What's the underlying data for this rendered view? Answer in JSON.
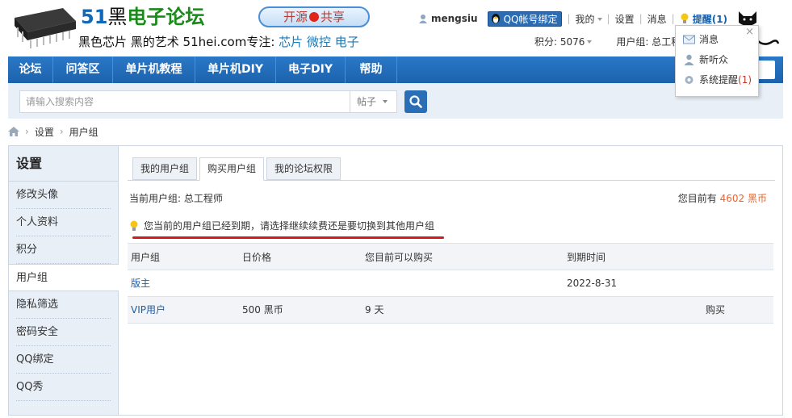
{
  "brand": {
    "num": "51",
    "hei": "黑",
    "rest": "电子论坛",
    "slogan_lead": "黑色芯片 黑的艺术 51hei.com专注:",
    "slogan_kw1": "芯片",
    "slogan_kw2": "微控",
    "slogan_kw3": "电子",
    "badge_left": "开源",
    "badge_right": "共享"
  },
  "topbar": {
    "username": "mengsiu",
    "qq_bind": "QQ帐号绑定",
    "mine": "我的",
    "settings": "设置",
    "messages": "消息",
    "remind": "提醒(1)"
  },
  "subbar": {
    "points": "积分: 5076",
    "usergroup": "用户组: 总工程"
  },
  "nav": {
    "items": [
      "论坛",
      "问答区",
      "单片机教程",
      "单片机DIY",
      "电子DIY",
      "帮助"
    ]
  },
  "search": {
    "placeholder": "请输入搜索内容",
    "type": "帖子"
  },
  "breadcrumb": {
    "item1": "设置",
    "item2": "用户组"
  },
  "sidebar": {
    "title": "设置",
    "items": [
      "修改头像",
      "个人资料",
      "积分",
      "用户组",
      "隐私筛选",
      "密码安全",
      "QQ绑定",
      "QQ秀"
    ]
  },
  "tabs": [
    "我的用户组",
    "购买用户组",
    "我的论坛权限"
  ],
  "status": {
    "current_group": "当前用户组: 总工程师",
    "balance_prefix": "您目前有",
    "balance_amount": "4602 黑币"
  },
  "notice": "您当前的用户组已经到期，请选择继续续费还是要切换到其他用户组",
  "table": {
    "headers": [
      "用户组",
      "日价格",
      "您目前可以购买",
      "到期时间",
      ""
    ],
    "rows": [
      [
        "版主",
        "",
        "",
        "2022-8-31",
        ""
      ],
      [
        "VIP用户",
        "500 黑币",
        "9 天",
        "",
        "购买"
      ]
    ]
  },
  "dropdown": {
    "close": "×",
    "msg": "消息",
    "listener": "新听众",
    "sys": "系统提醒",
    "sys_count": "(1)"
  },
  "colors": {
    "nav_blue": "#1c62ac",
    "link_blue": "#1a5faa",
    "accent_orange": "#e8652e",
    "red_underline": "#d11a1a"
  }
}
